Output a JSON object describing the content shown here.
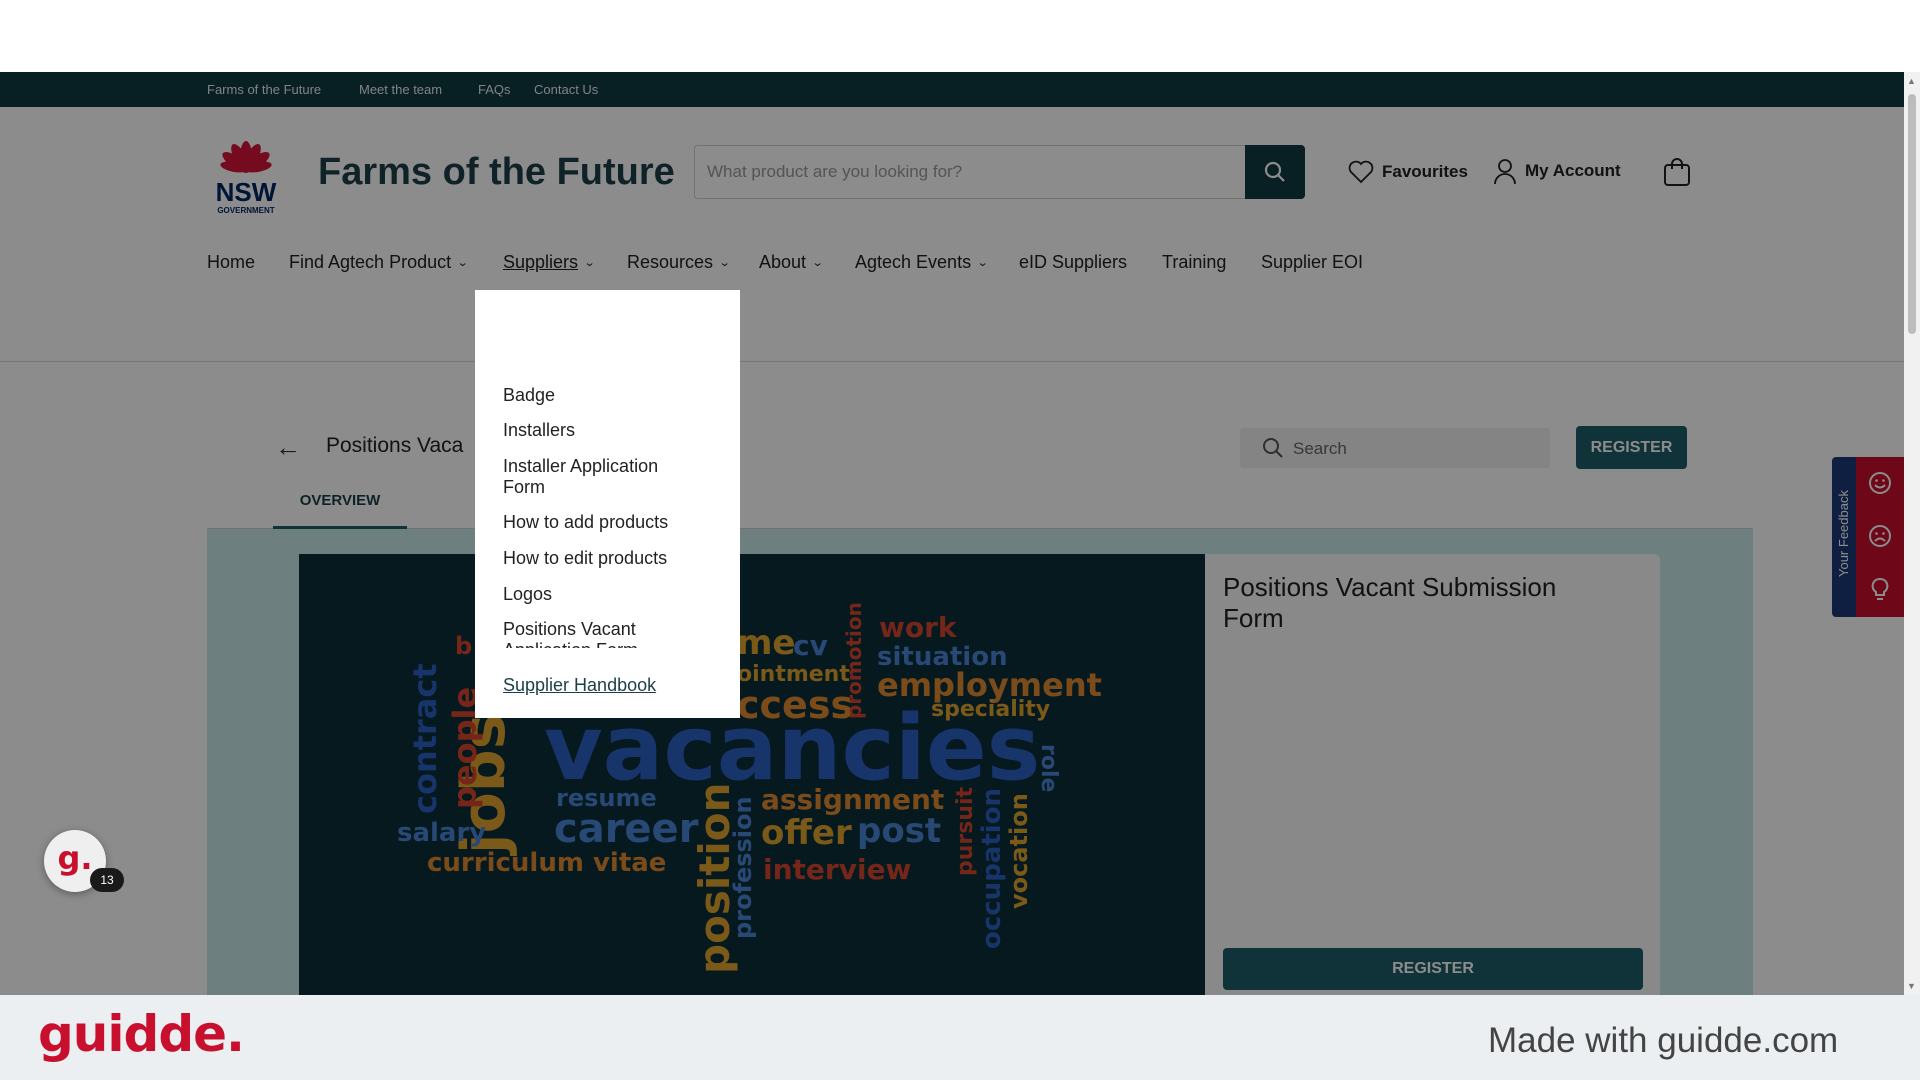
{
  "utility_nav": [
    "Farms of the Future",
    "Meet the team",
    "FAQs",
    "Contact Us"
  ],
  "header": {
    "logo_text": "NSW",
    "logo_sub": "GOVERNMENT",
    "site_title": "Farms of the Future",
    "search_placeholder": "What product are you looking for?",
    "favourites": "Favourites",
    "my_account": "My Account"
  },
  "nav": {
    "home": "Home",
    "find_agtech": "Find Agtech Product",
    "suppliers": "Suppliers",
    "resources": "Resources",
    "about": "About",
    "agtech_events": "Agtech Events",
    "eid_suppliers": "eID Suppliers",
    "training": "Training",
    "supplier_eoi": "Supplier EOI"
  },
  "dropdown": {
    "items": [
      "Badge",
      "Installers",
      "Installer Application Form",
      "How to add products",
      "How to edit products",
      "Logos",
      "Positions Vacant Application Form",
      "Supplier Handbook"
    ]
  },
  "page": {
    "title": "Positions Vaca",
    "search_placeholder": "Search",
    "register": "REGISTER",
    "tab_overview": "OVERVIEW",
    "card_title": "Positions Vacant Submission Form",
    "card_register": "REGISTER"
  },
  "word_cloud": {
    "words": [
      "vacancies",
      "jobs",
      "career",
      "position",
      "employment",
      "work",
      "situation",
      "speciality",
      "role",
      "cv",
      "me",
      "ointment",
      "ccess",
      "promotion",
      "assignment",
      "offer",
      "post",
      "interview",
      "resume",
      "salary",
      "curriculum vitae",
      "contract",
      "people",
      "b",
      "profession",
      "pursuit",
      "occupation",
      "vocation"
    ]
  },
  "feedback": {
    "label": "Your Feedback"
  },
  "help_widget": {
    "glyph": "g.",
    "badge": "13"
  },
  "footer": {
    "brand": "guidde.",
    "made_with": "Made with guidde.com"
  },
  "colors": {
    "dark_teal": "#0f3a40",
    "button_teal": "#1c5e68",
    "content_bg": "#c9e8e7",
    "nsw_red": "#c8102e",
    "feedback_blue": "#1d3a78"
  }
}
